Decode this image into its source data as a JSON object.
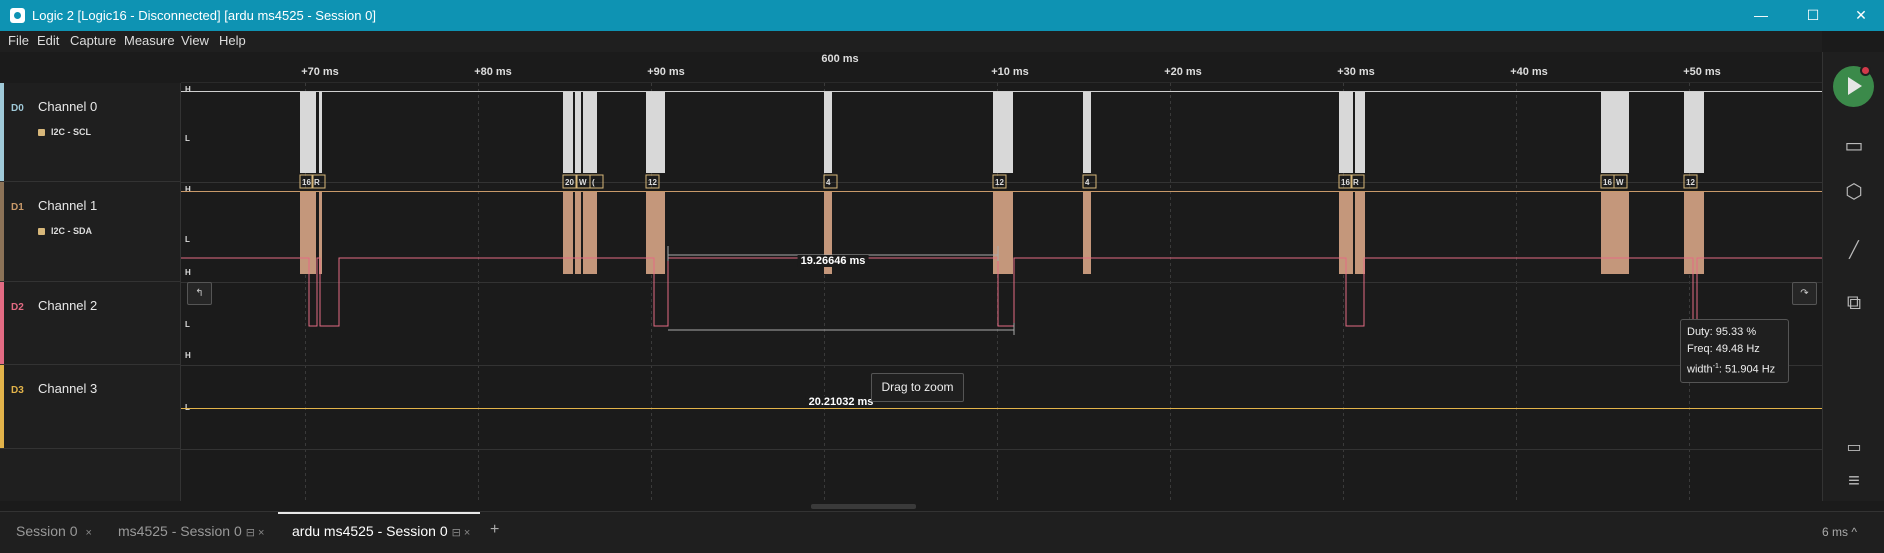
{
  "window": {
    "title": "Logic 2 [Logic16 - Disconnected] [ardu ms4525 - Session 0]",
    "minimize": "—",
    "maximize": "☐",
    "close": "✕"
  },
  "menu": [
    "File",
    "Edit",
    "Capture",
    "Measure",
    "View",
    "Help"
  ],
  "ruler": {
    "center_label": "600 ms",
    "ticks": [
      "+70 ms",
      "+80 ms",
      "+90 ms",
      "+10 ms",
      "+20 ms",
      "+30 ms",
      "+40 ms",
      "+50 ms"
    ]
  },
  "channels": [
    {
      "tag": "D0",
      "name": "Channel 0",
      "analyzer": "I2C - SCL",
      "color": "#9fc9d8",
      "high": "H",
      "low": "L"
    },
    {
      "tag": "D1",
      "name": "Channel 1",
      "analyzer": "I2C - SDA",
      "color": "#c99a6a",
      "high": "H",
      "low": "L"
    },
    {
      "tag": "D2",
      "name": "Channel 2",
      "color": "#e36b83",
      "high": "H",
      "low": "L"
    },
    {
      "tag": "D3",
      "name": "Channel 3",
      "color": "#e2b34a",
      "high": "H",
      "low": "L"
    }
  ],
  "i2c_labels": [
    "16",
    "R",
    "20",
    "W",
    "(",
    "12",
    "4",
    "12",
    "4",
    "16",
    "R",
    "16",
    "W",
    "12"
  ],
  "measurements": {
    "upper": "19.26646 ms",
    "lower": "20.21032 ms"
  },
  "drag_tip": "Drag to zoom",
  "tooltip": {
    "duty": "Duty: 95.33 %",
    "freq": "Freq: 49.48 Hz",
    "width_prefix": "width",
    "width_sup": "-1",
    "width_value": ": 51.904 Hz"
  },
  "edge_buttons": {
    "left": "↰",
    "right": "↷"
  },
  "sidebar_icons": [
    "play-icon",
    "device-icon",
    "analyzer-icon",
    "measure-icon",
    "extensions-icon",
    "comment-icon",
    "menu-icon"
  ],
  "sidebar_glyphs": {
    "device": "▭",
    "analyzer": "⬡",
    "measure": "📏",
    "extensions": "⧉",
    "comment": "💬",
    "menu": "≡"
  },
  "tabs": [
    {
      "label": "Session 0",
      "close": "×"
    },
    {
      "label": "ms4525 - Session 0",
      "close": "×",
      "lock": "🔒"
    },
    {
      "label": "ardu ms4525 - Session 0",
      "close": "×",
      "lock": "🔒",
      "active": true
    }
  ],
  "tab_add": "+",
  "timescale": "6 ms ^"
}
